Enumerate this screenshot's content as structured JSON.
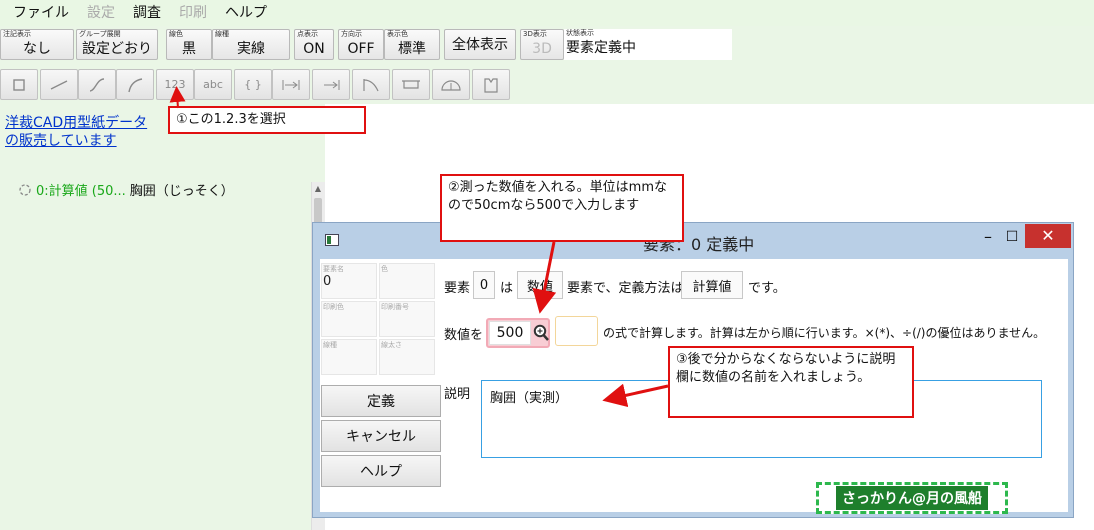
{
  "menu": [
    "ファイル",
    "設定",
    "調査",
    "印刷",
    "ヘルプ"
  ],
  "menu_disabled": [
    false,
    true,
    false,
    true,
    false
  ],
  "toolbar": [
    {
      "caption": "注記表示",
      "value": "なし"
    },
    {
      "caption": "グループ展開",
      "value": "設定どおり"
    },
    {
      "caption": "線色",
      "value": "黒"
    },
    {
      "caption": "線種",
      "value": "実線"
    },
    {
      "caption": "点表示",
      "value": "ON"
    },
    {
      "caption": "方向示",
      "value": "OFF"
    },
    {
      "caption": "表示色",
      "value": "標準"
    },
    {
      "caption": "",
      "value": "全体表示"
    },
    {
      "caption": "3D表示",
      "value": "3D"
    }
  ],
  "status": {
    "caption": "状態表示",
    "value": "要素定義中"
  },
  "tools": [
    {
      "icon": "square-icon",
      "text": ""
    },
    {
      "icon": "line-icon",
      "text": ""
    },
    {
      "icon": "curve-icon",
      "text": ""
    },
    {
      "icon": "arc-icon",
      "text": ""
    },
    {
      "icon": "number-icon",
      "text": "123"
    },
    {
      "icon": "text-icon",
      "text": "abc"
    },
    {
      "icon": "brace-icon",
      "text": "{ }"
    },
    {
      "icon": "measure-both-icon",
      "text": ""
    },
    {
      "icon": "measure-one-icon",
      "text": ""
    },
    {
      "icon": "corner-icon",
      "text": ""
    },
    {
      "icon": "pocket-icon",
      "text": ""
    },
    {
      "icon": "protractor-icon",
      "text": ""
    },
    {
      "icon": "tag-icon",
      "text": ""
    }
  ],
  "sidebar": {
    "link": "洋裁CAD用型紙データの販売しています",
    "tree_name": "0:計算値 (50...",
    "tree_desc": "胸囲（じっそく）"
  },
  "dialog": {
    "title": "要素：0 定義中",
    "props": [
      {
        "caption": "要素名",
        "value": "0"
      },
      {
        "caption": "色",
        "value": ""
      },
      {
        "caption": "印刷色",
        "value": ""
      },
      {
        "caption": "印刷番号",
        "value": ""
      },
      {
        "caption": "線種",
        "value": ""
      },
      {
        "caption": "線太さ",
        "value": ""
      }
    ],
    "buttons": {
      "define": "定義",
      "cancel": "キャンセル",
      "help": "ヘルプ"
    },
    "row1": {
      "label_element": "要素",
      "element_no": "0",
      "label_wa": "は",
      "kind": "数値",
      "label_mid": "要素で、定義方法は",
      "method": "計算値",
      "label_end": "です。"
    },
    "row2": {
      "label_value": "数値を",
      "value": "500",
      "unit": "",
      "tail": "の式で計算します。計算は左から順に行います。×(*)、÷(/)の優位はありません。"
    },
    "desc_label": "説明",
    "desc_value": "胸囲（実測）"
  },
  "notes": {
    "n1": "①この1.2.3を選択",
    "n2": "②測った数値を入れる。単位はmmなので50cmなら500で入力します",
    "n3": "③後で分からなくならないように説明欄に数値の名前を入れましょう。"
  },
  "brand": "さっかりん@月の風船"
}
